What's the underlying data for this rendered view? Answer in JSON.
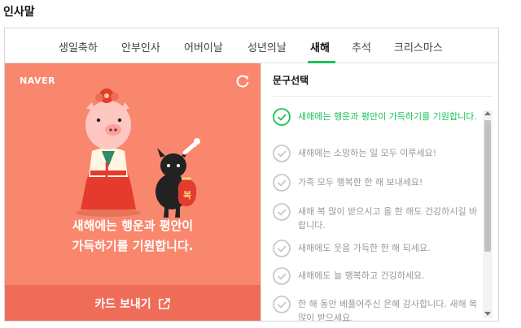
{
  "section_title": "인사말",
  "tabs": [
    {
      "label": "생일축하"
    },
    {
      "label": "안부인사"
    },
    {
      "label": "어버이날"
    },
    {
      "label": "성년의날"
    },
    {
      "label": "새해",
      "active": true
    },
    {
      "label": "추석"
    },
    {
      "label": "크리스마스"
    }
  ],
  "card": {
    "brand": "NAVER",
    "message_line1": "새해에는 행운과 평안이",
    "message_line2": "가득하기를 기원합니다.",
    "send_label": "카드 보내기",
    "lucky_bag_text": "복",
    "colors": {
      "background": "#f9876d",
      "button": "#ef6c58"
    }
  },
  "phrase_panel": {
    "title": "문구선택",
    "phrases": [
      {
        "text": "새해에는 행운과 평안이 가득하기를 기원합니다.",
        "selected": true
      },
      {
        "text": "새해에는 소망하는 일 모두 이루세요!"
      },
      {
        "text": "가족 모두 행복한 한 해 보내세요!"
      },
      {
        "text": "새해 복 많이 받으시고 올 한 해도 건강하시길 바랍니다."
      },
      {
        "text": "새해에도 웃음 가득한 한 해 되세요."
      },
      {
        "text": "새해에도 늘 행복하고 건강하세요."
      },
      {
        "text": "한 해 동안 베풀어주신 은혜 감사합니다. 새해 복 많이 받으세요."
      }
    ]
  },
  "icons": {
    "refresh": "refresh-icon",
    "share": "external-share-icon",
    "check": "check-circle-icon"
  },
  "colors": {
    "accent": "#19c259"
  }
}
